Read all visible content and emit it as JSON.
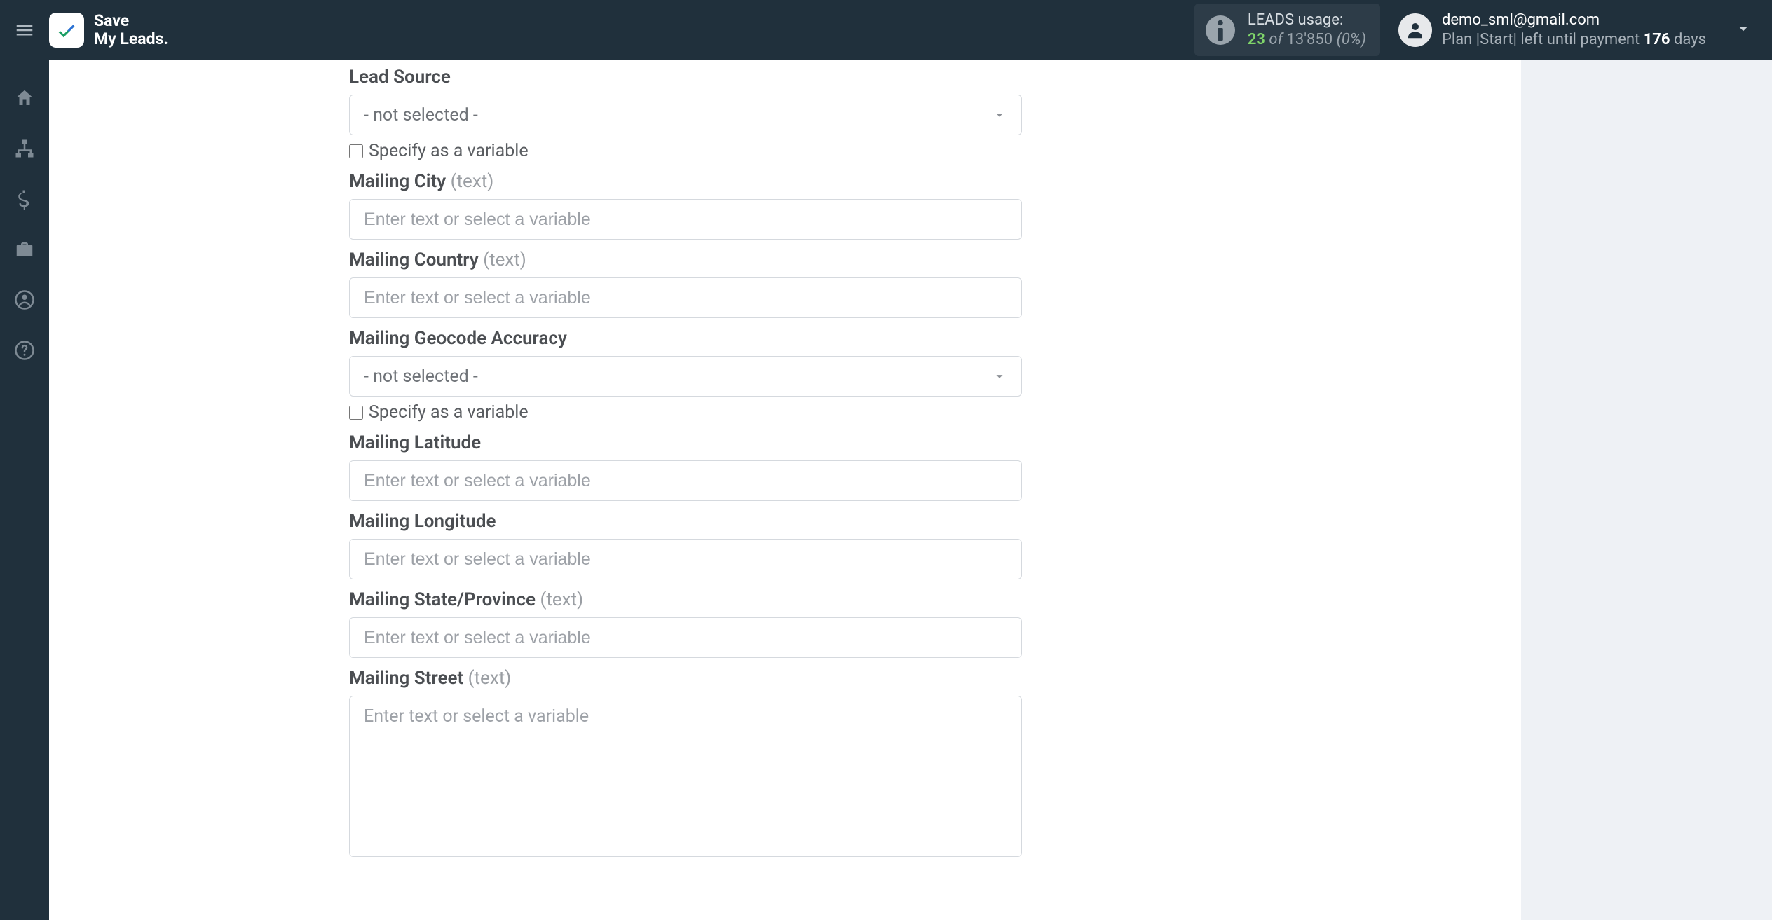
{
  "header": {
    "logo_line1": "Save",
    "logo_line2": "My Leads.",
    "usage": {
      "label": "LEADS usage:",
      "used": "23",
      "of": "of",
      "total": "13'850",
      "pct": "(0%)"
    },
    "user": {
      "email": "demo_sml@gmail.com",
      "plan_prefix": "Plan |Start| left until payment ",
      "plan_days": "176",
      "plan_suffix": " days"
    }
  },
  "sidebar": {
    "items": [
      {
        "name": "home"
      },
      {
        "name": "integrations"
      },
      {
        "name": "billing"
      },
      {
        "name": "briefcase"
      },
      {
        "name": "account"
      },
      {
        "name": "help"
      }
    ]
  },
  "form": {
    "text_placeholder": "Enter text or select a variable",
    "select_placeholder": "- not selected -",
    "variable_checkbox_label": "Specify as a variable",
    "hint_text": "(text)",
    "fields": {
      "lead_source": {
        "label": "Lead Source",
        "type": "select",
        "value": "",
        "checkbox": false
      },
      "mailing_city": {
        "label": "Mailing City",
        "type": "text",
        "hint": true,
        "value": ""
      },
      "mailing_country": {
        "label": "Mailing Country",
        "type": "text",
        "hint": true,
        "value": ""
      },
      "mailing_geocode_accuracy": {
        "label": "Mailing Geocode Accuracy",
        "type": "select",
        "value": "",
        "checkbox": false
      },
      "mailing_latitude": {
        "label": "Mailing Latitude",
        "type": "text",
        "hint": false,
        "value": ""
      },
      "mailing_longitude": {
        "label": "Mailing Longitude",
        "type": "text",
        "hint": false,
        "value": ""
      },
      "mailing_state": {
        "label": "Mailing State/Province",
        "type": "text",
        "hint": true,
        "value": ""
      },
      "mailing_street": {
        "label": "Mailing Street",
        "type": "textarea",
        "hint": true,
        "value": ""
      }
    }
  }
}
